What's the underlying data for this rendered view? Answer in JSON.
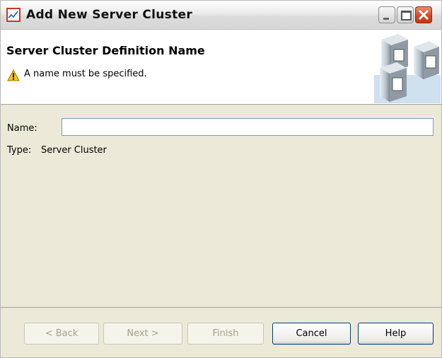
{
  "window": {
    "title": "Add New Server Cluster"
  },
  "header": {
    "heading": "Server Cluster Definition Name",
    "warning": "A name must be specified."
  },
  "form": {
    "name_label": "Name:",
    "name_value": "",
    "type_label": "Type:",
    "type_value": "Server Cluster"
  },
  "footer": {
    "back_label": "< Back",
    "next_label": "Next >",
    "finish_label": "Finish",
    "cancel_label": "Cancel",
    "help_label": "Help"
  },
  "colors": {
    "window_bg": "#ece9d8",
    "button_border": "#003c74",
    "close_button": "#d6431f"
  },
  "icons": {
    "app": "chart-app-icon",
    "warning": "warning-icon",
    "banner": "servers-icon"
  }
}
